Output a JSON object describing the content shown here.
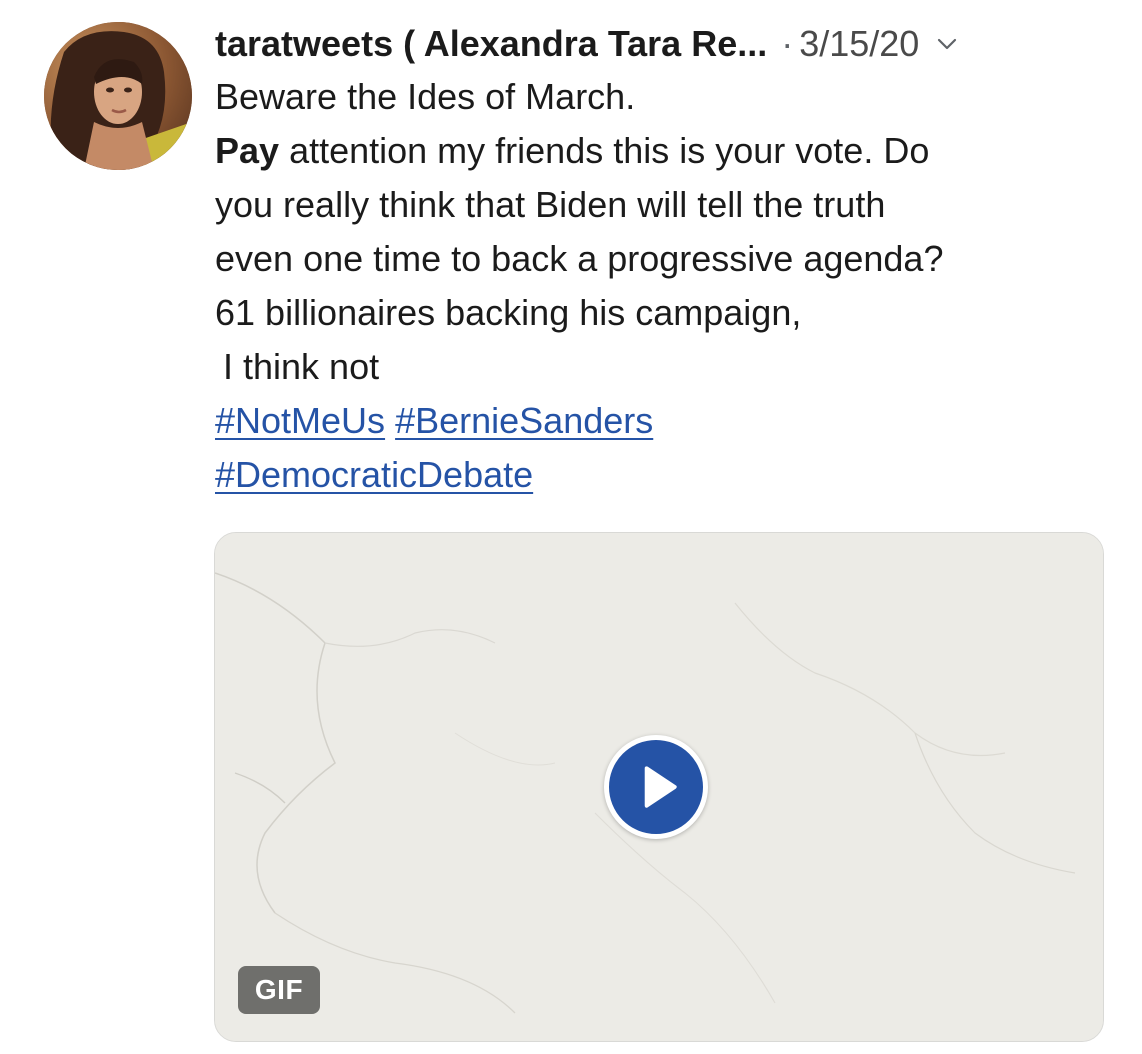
{
  "tweet": {
    "author": {
      "display": "taratweets ( Alexandra Tara Re...",
      "avatar_icon": "profile-photo"
    },
    "separator": "·",
    "date": "3/15/20",
    "menu_icon": "chevron-down-icon",
    "text": {
      "line1": "Beware the Ides of March.",
      "line2_bold": "Pay",
      "line2_rest": " attention my friends this is your vote. Do",
      "line3": "you really think that Biden will tell the truth",
      "line4": "even one time to back a progressive agenda?",
      "line5": "61 billionaires backing his campaign,",
      "line6": "I think not"
    },
    "hashtags": [
      "#NotMeUs",
      "#BernieSanders",
      "#DemocraticDebate"
    ],
    "media": {
      "badge": "GIF",
      "play_icon": "play-icon"
    }
  },
  "colors": {
    "link": "#2553a6",
    "play_button": "#2553a6",
    "gif_badge": "#6f6f6c",
    "media_background": "#ecebe6"
  }
}
